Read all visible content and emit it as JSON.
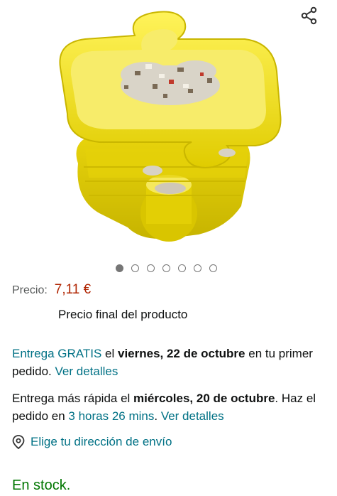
{
  "product": {
    "image_alt": "",
    "dots_total": 7,
    "dots_active_index": 0
  },
  "share": {
    "icon": "share-icon"
  },
  "price": {
    "label": "Precio:",
    "value": "7,11 €",
    "note": "Precio final del producto"
  },
  "delivery_free": {
    "prefix": "Entrega GRATIS",
    "middle": " el ",
    "date": "viernes, 22 de octubre",
    "suffix": " en tu primer pedido. ",
    "link": "Ver detalles"
  },
  "delivery_fast": {
    "prefix": "Entrega más rápida el ",
    "date": "miércoles, 20 de octubre",
    "middle": ". Haz el pedido en ",
    "time": "3 horas 26 mins",
    "suffix": ". ",
    "link": "Ver detalles"
  },
  "address": {
    "icon": "location-pin-icon",
    "label": "Elige tu dirección de envío"
  },
  "stock": {
    "label": "En stock."
  },
  "colors": {
    "link": "#007185",
    "price": "#b12704",
    "stock": "#007600",
    "tray": "#f5e31a"
  }
}
